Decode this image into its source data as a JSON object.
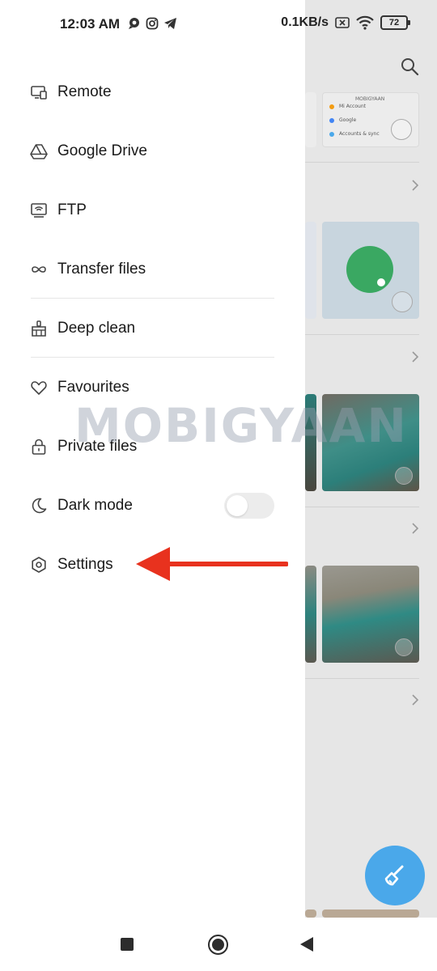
{
  "status_bar": {
    "time": "12:03 AM",
    "net_speed": "0.1KB/s",
    "battery": "72",
    "left_icons": [
      "chat-icon",
      "instagram-icon",
      "telegram-icon"
    ],
    "right_icons": [
      "sim-off-icon",
      "wifi-icon",
      "battery-icon"
    ]
  },
  "drawer": {
    "items": [
      {
        "label": "Remote",
        "icon": "remote-icon"
      },
      {
        "label": "Google Drive",
        "icon": "google-drive-icon"
      },
      {
        "label": "FTP",
        "icon": "ftp-icon"
      },
      {
        "label": "Transfer files",
        "icon": "infinity-icon"
      },
      {
        "label": "Deep clean",
        "icon": "broom-icon"
      },
      {
        "label": "Favourites",
        "icon": "heart-icon"
      },
      {
        "label": "Private files",
        "icon": "lock-icon"
      },
      {
        "label": "Dark mode",
        "icon": "moon-icon"
      },
      {
        "label": "Settings",
        "icon": "gear-icon"
      }
    ],
    "dark_mode_enabled": false
  },
  "background": {
    "mini_list": [
      "Mi Account",
      "Google",
      "Accounts & sync"
    ],
    "mini_header": "MOBIGYAAN"
  },
  "watermark": "MOBIGYAAN",
  "colors": {
    "accent_fab": "#4aa8ea",
    "arrow": "#e8321e",
    "toggle_off": "#ececec"
  },
  "nav": {
    "icons": [
      "recents-icon",
      "home-icon",
      "back-icon"
    ]
  }
}
